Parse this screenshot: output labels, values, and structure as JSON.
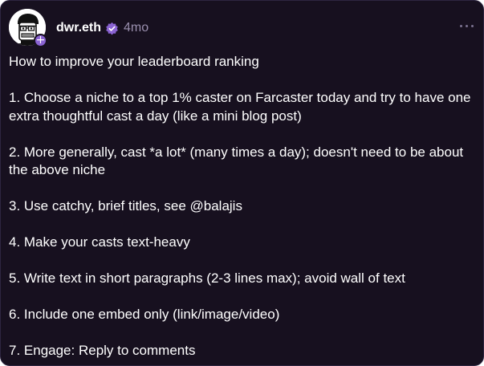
{
  "cast": {
    "author": {
      "username": "dwr.eth",
      "avatar_icon": "cartoon-face-avatar",
      "verified_icon": "verified-badge-icon",
      "verified_color": "#8a63d2",
      "follow_icon": "plus-icon"
    },
    "timestamp": "4mo",
    "more_icon": "more-options-icon",
    "paragraphs": [
      "How to improve your leaderboard ranking",
      "1. Choose a niche to a top 1% caster on Farcaster today and try to have one extra thoughtful cast a day (like a mini blog post)",
      "2. More generally, cast *a lot* (many times a day); doesn't need to be about the above niche",
      "3. Use catchy, brief titles, see @balajis",
      "4. Make your casts text-heavy",
      "5. Write text in short paragraphs (2-3 lines max); avoid wall of text",
      "6. Include one embed only (link/image/video)",
      "7. Engage: Reply to comments"
    ]
  }
}
